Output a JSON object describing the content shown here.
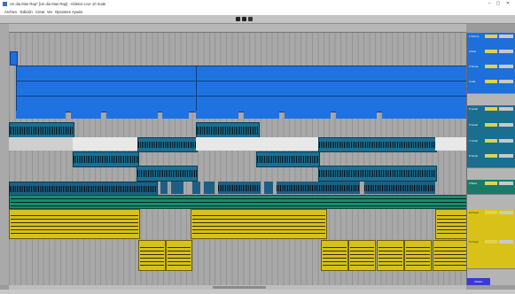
{
  "window": {
    "title": "Un dia Mas Rap* [Un dia Mas Rap] - Ableton Live 10 Suite",
    "minimize": "–",
    "maximize": "▢",
    "close": "✕"
  },
  "menu": [
    "Archivo",
    "Edición",
    "Crear",
    "Ver",
    "Opciones",
    "Ayuda"
  ],
  "tracks": [
    {
      "name": "1 Drums",
      "color": "#1e6fd9"
    },
    {
      "name": "2 Kick",
      "color": "#1e6fd9"
    },
    {
      "name": "3 Snare",
      "color": "#1e6fd9"
    },
    {
      "name": "4 Hat",
      "color": "#1e6fd9"
    },
    {
      "name": "5 Vocal",
      "color": "#1a6f91"
    },
    {
      "name": "6 Vocal",
      "color": "#1a6f91"
    },
    {
      "name": "7 Vocal",
      "color": "#1a6f91"
    },
    {
      "name": "8 Vocal",
      "color": "#1a6f91"
    },
    {
      "name": "9 Bass",
      "color": "#1a7a6a"
    },
    {
      "name": "10 Keys",
      "color": "#d8c21a"
    },
    {
      "name": "11 Keys",
      "color": "#d8c21a"
    }
  ],
  "master": "Master"
}
